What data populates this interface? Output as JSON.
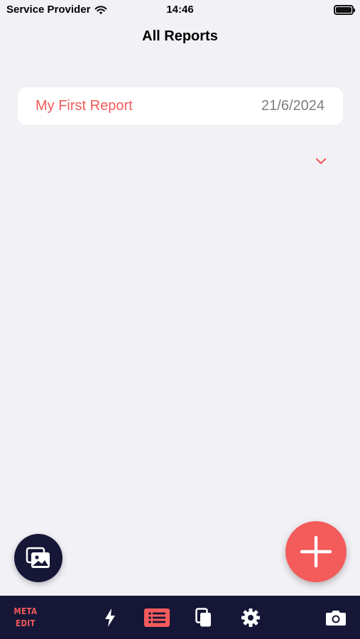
{
  "status_bar": {
    "carrier": "Service Provider",
    "time": "14:46"
  },
  "nav": {
    "title": "All Reports"
  },
  "reports": [
    {
      "name": "My First Report",
      "date": "21/6/2024"
    }
  ],
  "tab_bar": {
    "logo_line1": "META",
    "logo_line2": "EDIT",
    "active_tab": "reports-list",
    "items": [
      "quick-actions",
      "reports-list",
      "copy",
      "settings",
      "camera"
    ]
  },
  "colors": {
    "accent": "#f45b5b",
    "dark": "#161737",
    "background": "#f2f1f6",
    "date_text": "#7d7d7d"
  },
  "icons": {
    "gallery_fab": "photo-gallery-icon",
    "add_fab": "plus-icon",
    "chevron": "chevron-down-icon"
  }
}
